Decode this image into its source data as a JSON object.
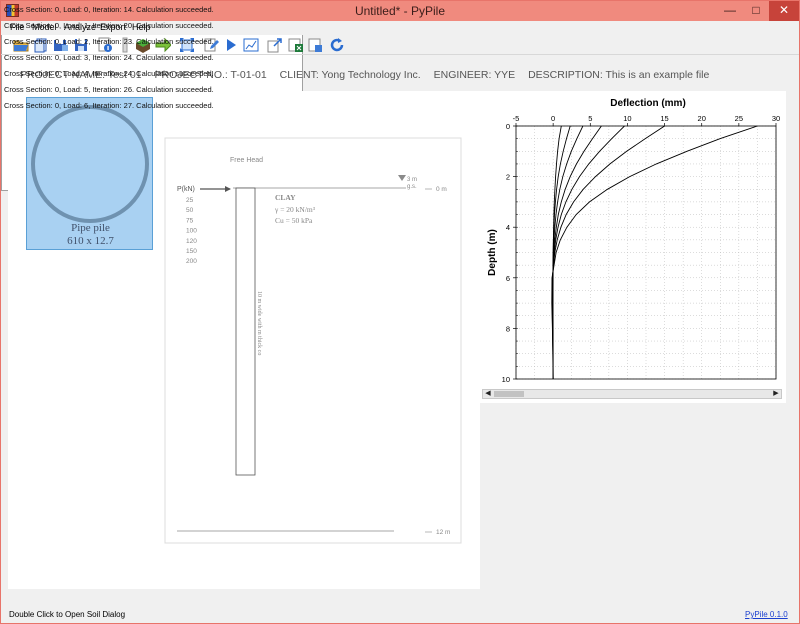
{
  "window": {
    "title": "Untitled* - PyPile",
    "minimize": "—",
    "maximize": "□",
    "close": "✕"
  },
  "menu": [
    "File",
    "Model",
    "Analyze",
    "Export",
    "Help"
  ],
  "toolbar": [
    "open-folder-icon",
    "new-file-icon",
    "save-as-icon",
    "save-icon",
    "info-icon",
    "pile-icon",
    "soil-icon",
    "load-arrow-icon",
    "fit-view-icon",
    "edit-icon",
    "run-icon",
    "chart-icon",
    "export-icon",
    "export-excel-icon",
    "report-icon",
    "refresh-icon"
  ],
  "project": {
    "name": "PROJECT NAME: Test 01",
    "number": "PROJECT NO.: T-01-01",
    "client": "CLIENT: Yong Technology Inc.",
    "engineer": "ENGINEER: YYE",
    "description": "DESCRIPTION: This is an example file"
  },
  "pile": {
    "name": "Pipe pile",
    "size": "610 x 12.7"
  },
  "model": {
    "head_label": "Free Head",
    "load_header": "P(kN)",
    "loads": [
      "25",
      "50",
      "75",
      "100",
      "120",
      "150",
      "200"
    ],
    "water_level": "3 m",
    "ground_abbrev": "g.s.",
    "top_depth": "0 m",
    "bottom_depth": "12 m",
    "soil_name": "CLAY",
    "soil_gamma": "γ = 20 kN/m³",
    "soil_cu": "Cu = 50 kPa",
    "pile_label": "10 m wide with m thick co"
  },
  "chart_data": {
    "type": "line",
    "title": "Deflection (mm)",
    "xlabel": "Deflection (mm)",
    "ylabel": "Depth (m)",
    "xlim": [
      -5,
      30
    ],
    "ylim": [
      0,
      10
    ],
    "xticks": [
      "-5",
      "0",
      "5",
      "10",
      "15",
      "20",
      "25",
      "30"
    ],
    "yticks": [
      "0",
      "2",
      "4",
      "6",
      "8",
      "10"
    ],
    "grid": true,
    "y_inverted": true,
    "x_axis_position": "top",
    "series": [
      {
        "depth": [
          0,
          0.5,
          1,
          1.5,
          2,
          2.5,
          3,
          3.5,
          4,
          4.5,
          5,
          6,
          7,
          8,
          9,
          10
        ],
        "values": [
          1.1,
          0.8,
          0.6,
          0.45,
          0.33,
          0.23,
          0.16,
          0.1,
          0.06,
          0.03,
          0.01,
          0,
          -0.02,
          -0.01,
          0,
          0
        ]
      },
      {
        "depth": [
          0,
          0.5,
          1,
          1.5,
          2,
          2.5,
          3,
          3.5,
          4,
          4.5,
          5,
          6,
          7,
          8,
          9,
          10
        ],
        "values": [
          2.3,
          1.8,
          1.35,
          0.98,
          0.68,
          0.46,
          0.3,
          0.18,
          0.1,
          0.04,
          0.01,
          -0.04,
          -0.04,
          -0.02,
          -0.01,
          0
        ]
      },
      {
        "depth": [
          0,
          0.5,
          1,
          1.5,
          2,
          2.5,
          3,
          3.5,
          4,
          4.5,
          5,
          6,
          7,
          8,
          9,
          10
        ],
        "values": [
          4.0,
          3.2,
          2.45,
          1.82,
          1.3,
          0.9,
          0.6,
          0.38,
          0.22,
          0.11,
          0.04,
          -0.05,
          -0.06,
          -0.04,
          -0.02,
          0
        ]
      },
      {
        "depth": [
          0,
          0.5,
          1,
          1.5,
          2,
          2.5,
          3,
          3.5,
          4,
          4.5,
          5,
          6,
          7,
          8,
          9,
          10
        ],
        "values": [
          6.5,
          5.3,
          4.15,
          3.15,
          2.3,
          1.62,
          1.1,
          0.7,
          0.42,
          0.22,
          0.09,
          -0.06,
          -0.08,
          -0.05,
          -0.02,
          0
        ]
      },
      {
        "depth": [
          0,
          0.5,
          1,
          1.5,
          2,
          2.5,
          3,
          3.5,
          4,
          4.5,
          5,
          6,
          7,
          8,
          9,
          10
        ],
        "values": [
          9.6,
          7.9,
          6.25,
          4.8,
          3.55,
          2.53,
          1.72,
          1.1,
          0.66,
          0.35,
          0.14,
          -0.08,
          -0.1,
          -0.06,
          -0.02,
          0
        ]
      },
      {
        "depth": [
          0,
          0.5,
          1,
          1.5,
          2,
          2.5,
          3,
          3.5,
          4,
          4.5,
          5,
          6,
          7,
          8,
          9,
          10
        ],
        "values": [
          15.0,
          12.4,
          9.9,
          7.65,
          5.7,
          4.05,
          2.75,
          1.76,
          1.05,
          0.55,
          0.22,
          -0.1,
          -0.13,
          -0.08,
          -0.03,
          0
        ]
      },
      {
        "depth": [
          0,
          0.5,
          1,
          1.5,
          2,
          2.5,
          3,
          3.5,
          4,
          4.5,
          5,
          6,
          7,
          8,
          9,
          10
        ],
        "values": [
          27.5,
          22.5,
          18.0,
          13.9,
          10.3,
          7.3,
          4.9,
          3.1,
          1.85,
          0.97,
          0.4,
          -0.15,
          -0.18,
          -0.1,
          -0.04,
          0
        ]
      }
    ]
  },
  "log": [
    "Cross Section: 0, Load: 0, Iteration: 14. Calculation succeeded.",
    "Cross Section: 0, Load: 1, Iteration: 20. Calculation succeeded.",
    "Cross Section: 0, Load: 2, Iteration: 23. Calculation succeeded.",
    "Cross Section: 0, Load: 3, Iteration: 24. Calculation succeeded.",
    "Cross Section: 0, Load: 4, Iteration: 24. Calculation succeeded.",
    "Cross Section: 0, Load: 5, Iteration: 26. Calculation succeeded.",
    "Cross Section: 0, Load: 6, Iteration: 27. Calculation succeeded."
  ],
  "status": {
    "hint": "Double Click to Open Soil Dialog",
    "version": "PyPile 0.1.0"
  },
  "colors": {
    "titlebar": "#f08a7e",
    "selection": "#a9d1f2",
    "link": "#1a3fd0"
  }
}
